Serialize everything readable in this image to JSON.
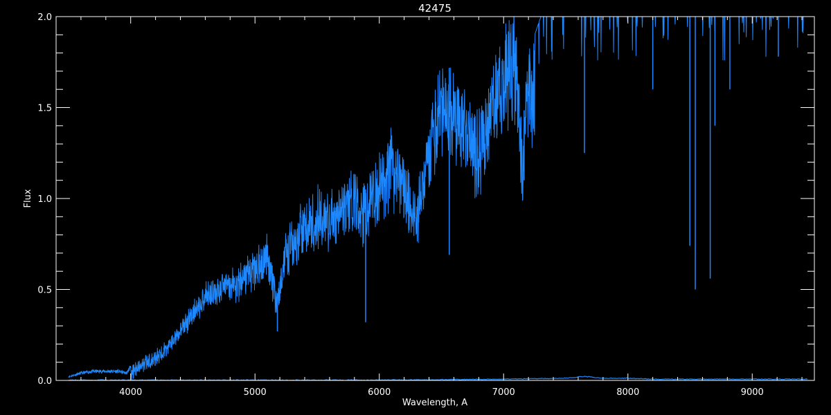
{
  "colors": {
    "background": "#000000",
    "axes": "#ffffff",
    "series": "#1e88ff"
  },
  "chart_data": {
    "type": "line",
    "title": "42475",
    "xlabel": "Wavelength, A",
    "ylabel": "Flux",
    "xlim": [
      3400,
      9500
    ],
    "ylim": [
      0,
      2.0
    ],
    "x_ticks": [
      4000,
      5000,
      6000,
      7000,
      8000,
      9000
    ],
    "x_tick_labels": [
      "4000",
      "5000",
      "6000",
      "7000",
      "8000",
      "9000"
    ],
    "y_ticks": [
      0,
      0.5,
      1.0,
      1.5,
      2.0
    ],
    "y_tick_labels": [
      "0.0",
      "0.5",
      "1.0",
      "1.5",
      "2.0"
    ],
    "grid": false,
    "series": [
      {
        "x": [
          3500,
          3600,
          3700,
          3800,
          3900,
          3970,
          4000,
          4100,
          4200,
          4300,
          4400,
          4500,
          4600,
          4700,
          4800,
          4900,
          5000,
          5100,
          5180,
          5250,
          5400,
          5500,
          5600,
          5700,
          5800,
          5890,
          6000,
          6100,
          6200,
          6300,
          6400,
          6500,
          6600,
          6700,
          6800,
          6900,
          7000,
          7100,
          7150,
          7200,
          7300,
          7500,
          7700,
          8000,
          8200,
          8400,
          8500,
          8600,
          8700,
          8800,
          9000,
          9200,
          9300,
          9450
        ],
        "y": [
          0.02,
          0.04,
          0.05,
          0.05,
          0.05,
          0.04,
          0.08,
          0.13,
          0.17,
          0.22,
          0.33,
          0.42,
          0.53,
          0.57,
          0.6,
          0.63,
          0.72,
          0.78,
          0.48,
          0.82,
          0.98,
          1.05,
          1.0,
          1.1,
          1.15,
          1.05,
          1.25,
          1.35,
          1.2,
          1.05,
          1.45,
          1.75,
          1.7,
          1.55,
          1.45,
          1.7,
          1.95,
          2.0,
          1.35,
          1.8,
          2.0,
          2.0,
          2.0,
          2.0,
          2.0,
          2.0,
          2.0,
          2.0,
          2.0,
          2.0,
          2.0,
          2.0,
          2.0,
          2.0
        ]
      },
      {
        "x": [
          3500,
          4000,
          5000,
          6000,
          7000,
          7500,
          7650,
          7800,
          8000,
          8200,
          9000,
          9450
        ],
        "y": [
          0.0,
          0.0,
          0.0,
          0.0,
          0.005,
          0.01,
          0.02,
          0.01,
          0.01,
          0.005,
          0.005,
          0.005
        ]
      }
    ],
    "absorption_lines": [
      {
        "x": 5180,
        "y": 0.27
      },
      {
        "x": 5890,
        "y": 0.32
      },
      {
        "x": 6563,
        "y": 0.69
      },
      {
        "x": 7165,
        "y": 1.1
      },
      {
        "x": 7650,
        "y": 1.25
      },
      {
        "x": 8200,
        "y": 1.6
      },
      {
        "x": 8498,
        "y": 0.74
      },
      {
        "x": 8542,
        "y": 0.5
      },
      {
        "x": 8662,
        "y": 0.56
      },
      {
        "x": 8700,
        "y": 1.4
      },
      {
        "x": 8820,
        "y": 1.6
      },
      {
        "x": 9210,
        "y": 1.78
      }
    ]
  }
}
